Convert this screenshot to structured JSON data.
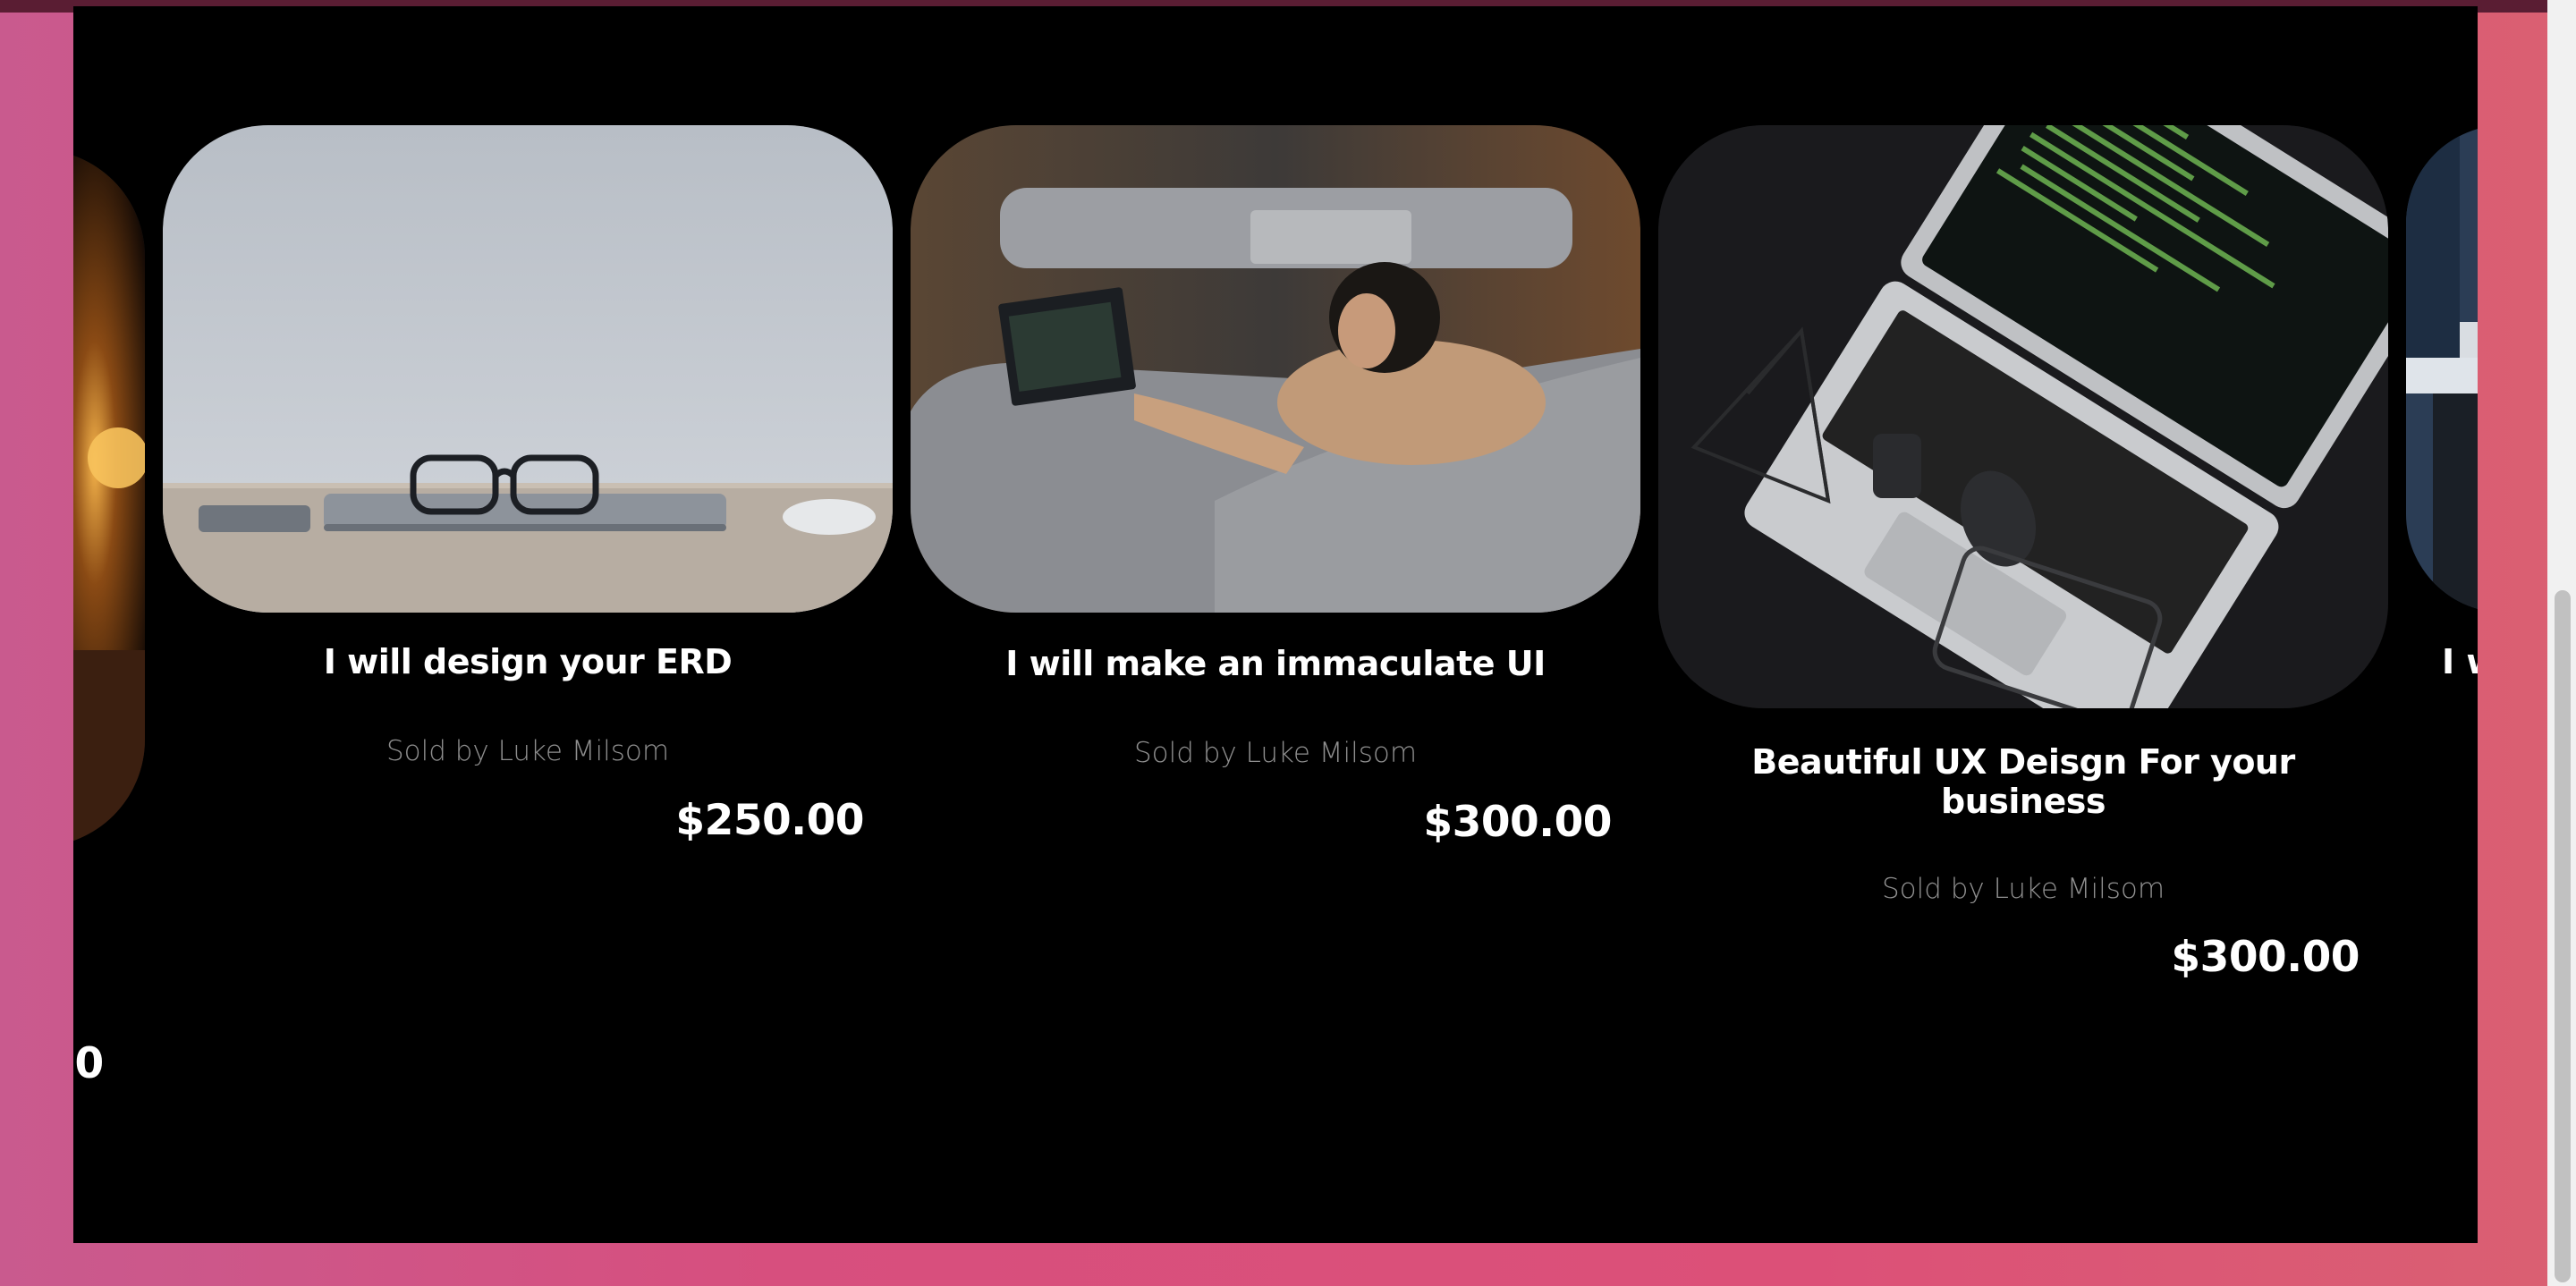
{
  "cards": [
    {
      "title": "I will design your ERD",
      "seller": "Sold by Luke Milsom",
      "price": "$250.00",
      "image": "desk-glasses-laptop-photo"
    },
    {
      "title": "I will make an immaculate UI",
      "seller": "Sold by Luke Milsom",
      "price": "$300.00",
      "image": "man-on-sofa-laptop-photo"
    },
    {
      "title_line1": "Beautiful UX Deisgn For your",
      "title_line2": "business",
      "seller": "Sold by Luke Milsom",
      "price": "$300.00",
      "image": "laptop-code-dark-desk-photo"
    }
  ],
  "partial_left": {
    "price": ")0",
    "image": "lamp-photo"
  },
  "partial_right": {
    "title": "I w",
    "image": "office-photo"
  },
  "colors": {
    "panel": "#000000",
    "background_gradient": [
      "#c95a8e",
      "#dc5078",
      "#da6072"
    ],
    "seller_text": "#8f8f8f"
  }
}
